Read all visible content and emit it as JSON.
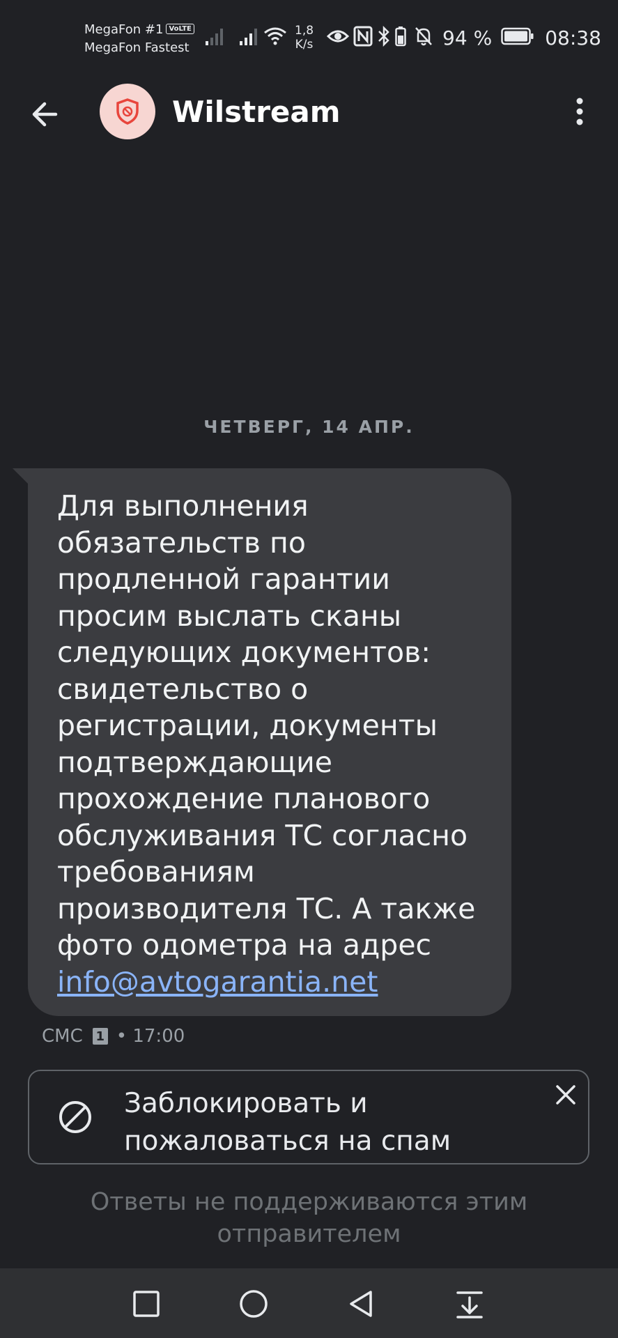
{
  "status_bar": {
    "carrier_1": "MegaFon #1",
    "volte_badge": "VoLTE",
    "carrier_2": "MegaFon Fastest",
    "speed_value": "1,8",
    "speed_unit": "K/s",
    "battery_percent": "94 %",
    "time": "08:38"
  },
  "app_bar": {
    "contact_name": "Wilstream",
    "avatar_color": "#f7d6d2",
    "avatar_icon": "shield-block-icon",
    "accent_red": "#e8453c"
  },
  "conversation": {
    "date_divider": "ЧЕТВЕРГ, 14 АПР.",
    "message": {
      "text": "Для выполнения\nобязательств по\nпродленной гарантии\nпросим выслать сканы\nследующих документов:\nсвидетельство о\nрегистрации, документы\nподтверждающие\nпрохождение планового\nобслуживания ТС согласно\nтребованиям\nпроизводителя ТС. А также\nфото одометра на адрес",
      "link": "info@avtogarantia.net",
      "type_label": "СМС",
      "sim_slot": "1",
      "time": "• 17:00"
    }
  },
  "spam_card": {
    "label": "Заблокировать и\nпожаловаться на спам",
    "icon": "block-icon",
    "dismiss_icon": "close-icon"
  },
  "reply_note": "Ответы не поддерживаются этим\nотправителем",
  "nav_bar": {
    "buttons": [
      "recents-icon",
      "home-icon",
      "back-icon",
      "notifications-pull-icon"
    ]
  }
}
